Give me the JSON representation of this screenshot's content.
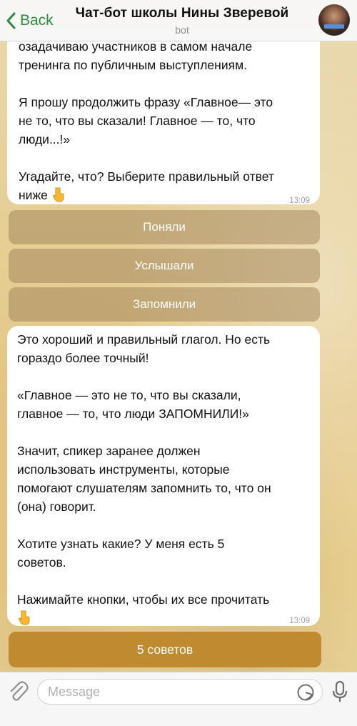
{
  "header": {
    "back_label": "Back",
    "title": "Чат-бот школы Нины Зверевой",
    "subtitle": "bot"
  },
  "messages": [
    {
      "text": "озадачиваю участников в самом начале\nтренинга по публичным выступлениям.\n\nЯ прошу продолжить фразу «Главное— это\nне то, что вы сказали! Главное — то, что\nлюди...!»\n\nУгадайте, что? Выберите правильный ответ\nниже",
      "time": "13:09",
      "emoji": "pointing-down-emoji"
    },
    {
      "text": "Это хороший и правильный глагол. Но есть\nгораздо более точный!\n\n«Главное — это не то, что вы сказали,\nглавное — то, что люди ЗАПОМНИЛИ!»\n\nЗначит, спикер заранее должен\nиспользовать инструменты, которые\nпомогают слушателям запомнить то, что он\n(она) говорит.\n\nХотите узнать какие? У меня есть 5\nсоветов.\n\nНажимайте кнопки, чтобы их все прочитать",
      "time": "13:09",
      "emoji": "pointing-down-emoji"
    }
  ],
  "inline_buttons": [
    "Поняли",
    "Услышали",
    "Запомнили"
  ],
  "main_button": "5 советов",
  "input": {
    "placeholder": "Message"
  },
  "colors": {
    "accent_green": "#2e8b3d",
    "button_gold": "#c08a31",
    "bubble_bg": "#ffffff"
  }
}
